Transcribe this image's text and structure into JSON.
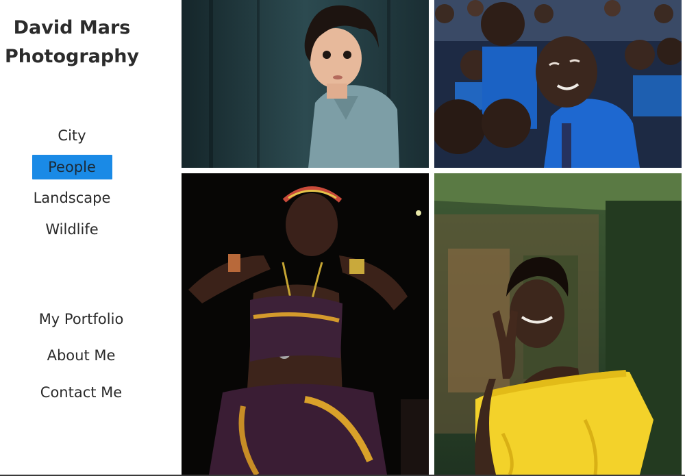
{
  "site": {
    "title_line1": "David Mars",
    "title_line2": "Photography"
  },
  "categories": [
    {
      "label": "City",
      "active": false
    },
    {
      "label": "People",
      "active": true
    },
    {
      "label": "Landscape",
      "active": false
    },
    {
      "label": "Wildlife",
      "active": false
    }
  ],
  "pages": [
    {
      "label": "My Portfolio"
    },
    {
      "label": "About Me"
    },
    {
      "label": "Contact Me"
    }
  ],
  "colors": {
    "active_highlight": "#1a8ae6",
    "text": "#2a2a2a",
    "background": "#ffffff"
  },
  "gallery": {
    "category": "People",
    "photos": [
      {
        "subject": "child-portrait"
      },
      {
        "subject": "schoolchildren-crowd"
      },
      {
        "subject": "woman-traditional-dress"
      },
      {
        "subject": "woman-yellow-top"
      }
    ]
  }
}
